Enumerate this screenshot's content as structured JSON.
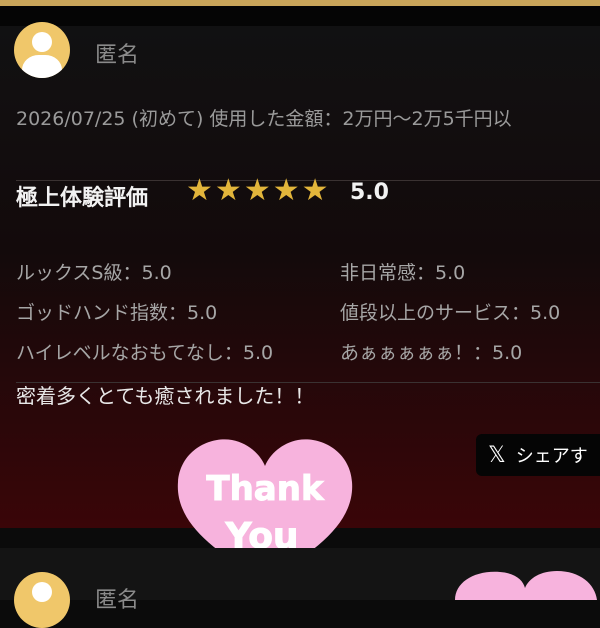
{
  "review": {
    "reviewer_name": "匿名",
    "meta_line": "2026/07/25 (初めて) 使用した金額：2万円〜2万5千円以",
    "rating_title": "極上体験評価",
    "stars": 5,
    "score": "5.0",
    "attributes": [
      "ルックスS級：5.0",
      "非日常感：5.0",
      "ゴッドハンド指数：5.0",
      "値段以上のサービス：5.0",
      "ハイレベルなおもてなし：5.0",
      "あぁぁぁぁぁ！：5.0"
    ],
    "comment": "密着多くとても癒されました！！",
    "share_label": "シェアす",
    "sticker_text": [
      "Thank",
      "You"
    ]
  },
  "next_review": {
    "reviewer_name": "匿名"
  },
  "colors": {
    "gold": "#c9a55a",
    "star": "#e2b53b",
    "avatar": "#f0c76a",
    "heart": "#f7b3dd"
  },
  "icons": {
    "avatar": "user-avatar-icon",
    "star": "star-icon",
    "x": "x-logo-icon"
  }
}
